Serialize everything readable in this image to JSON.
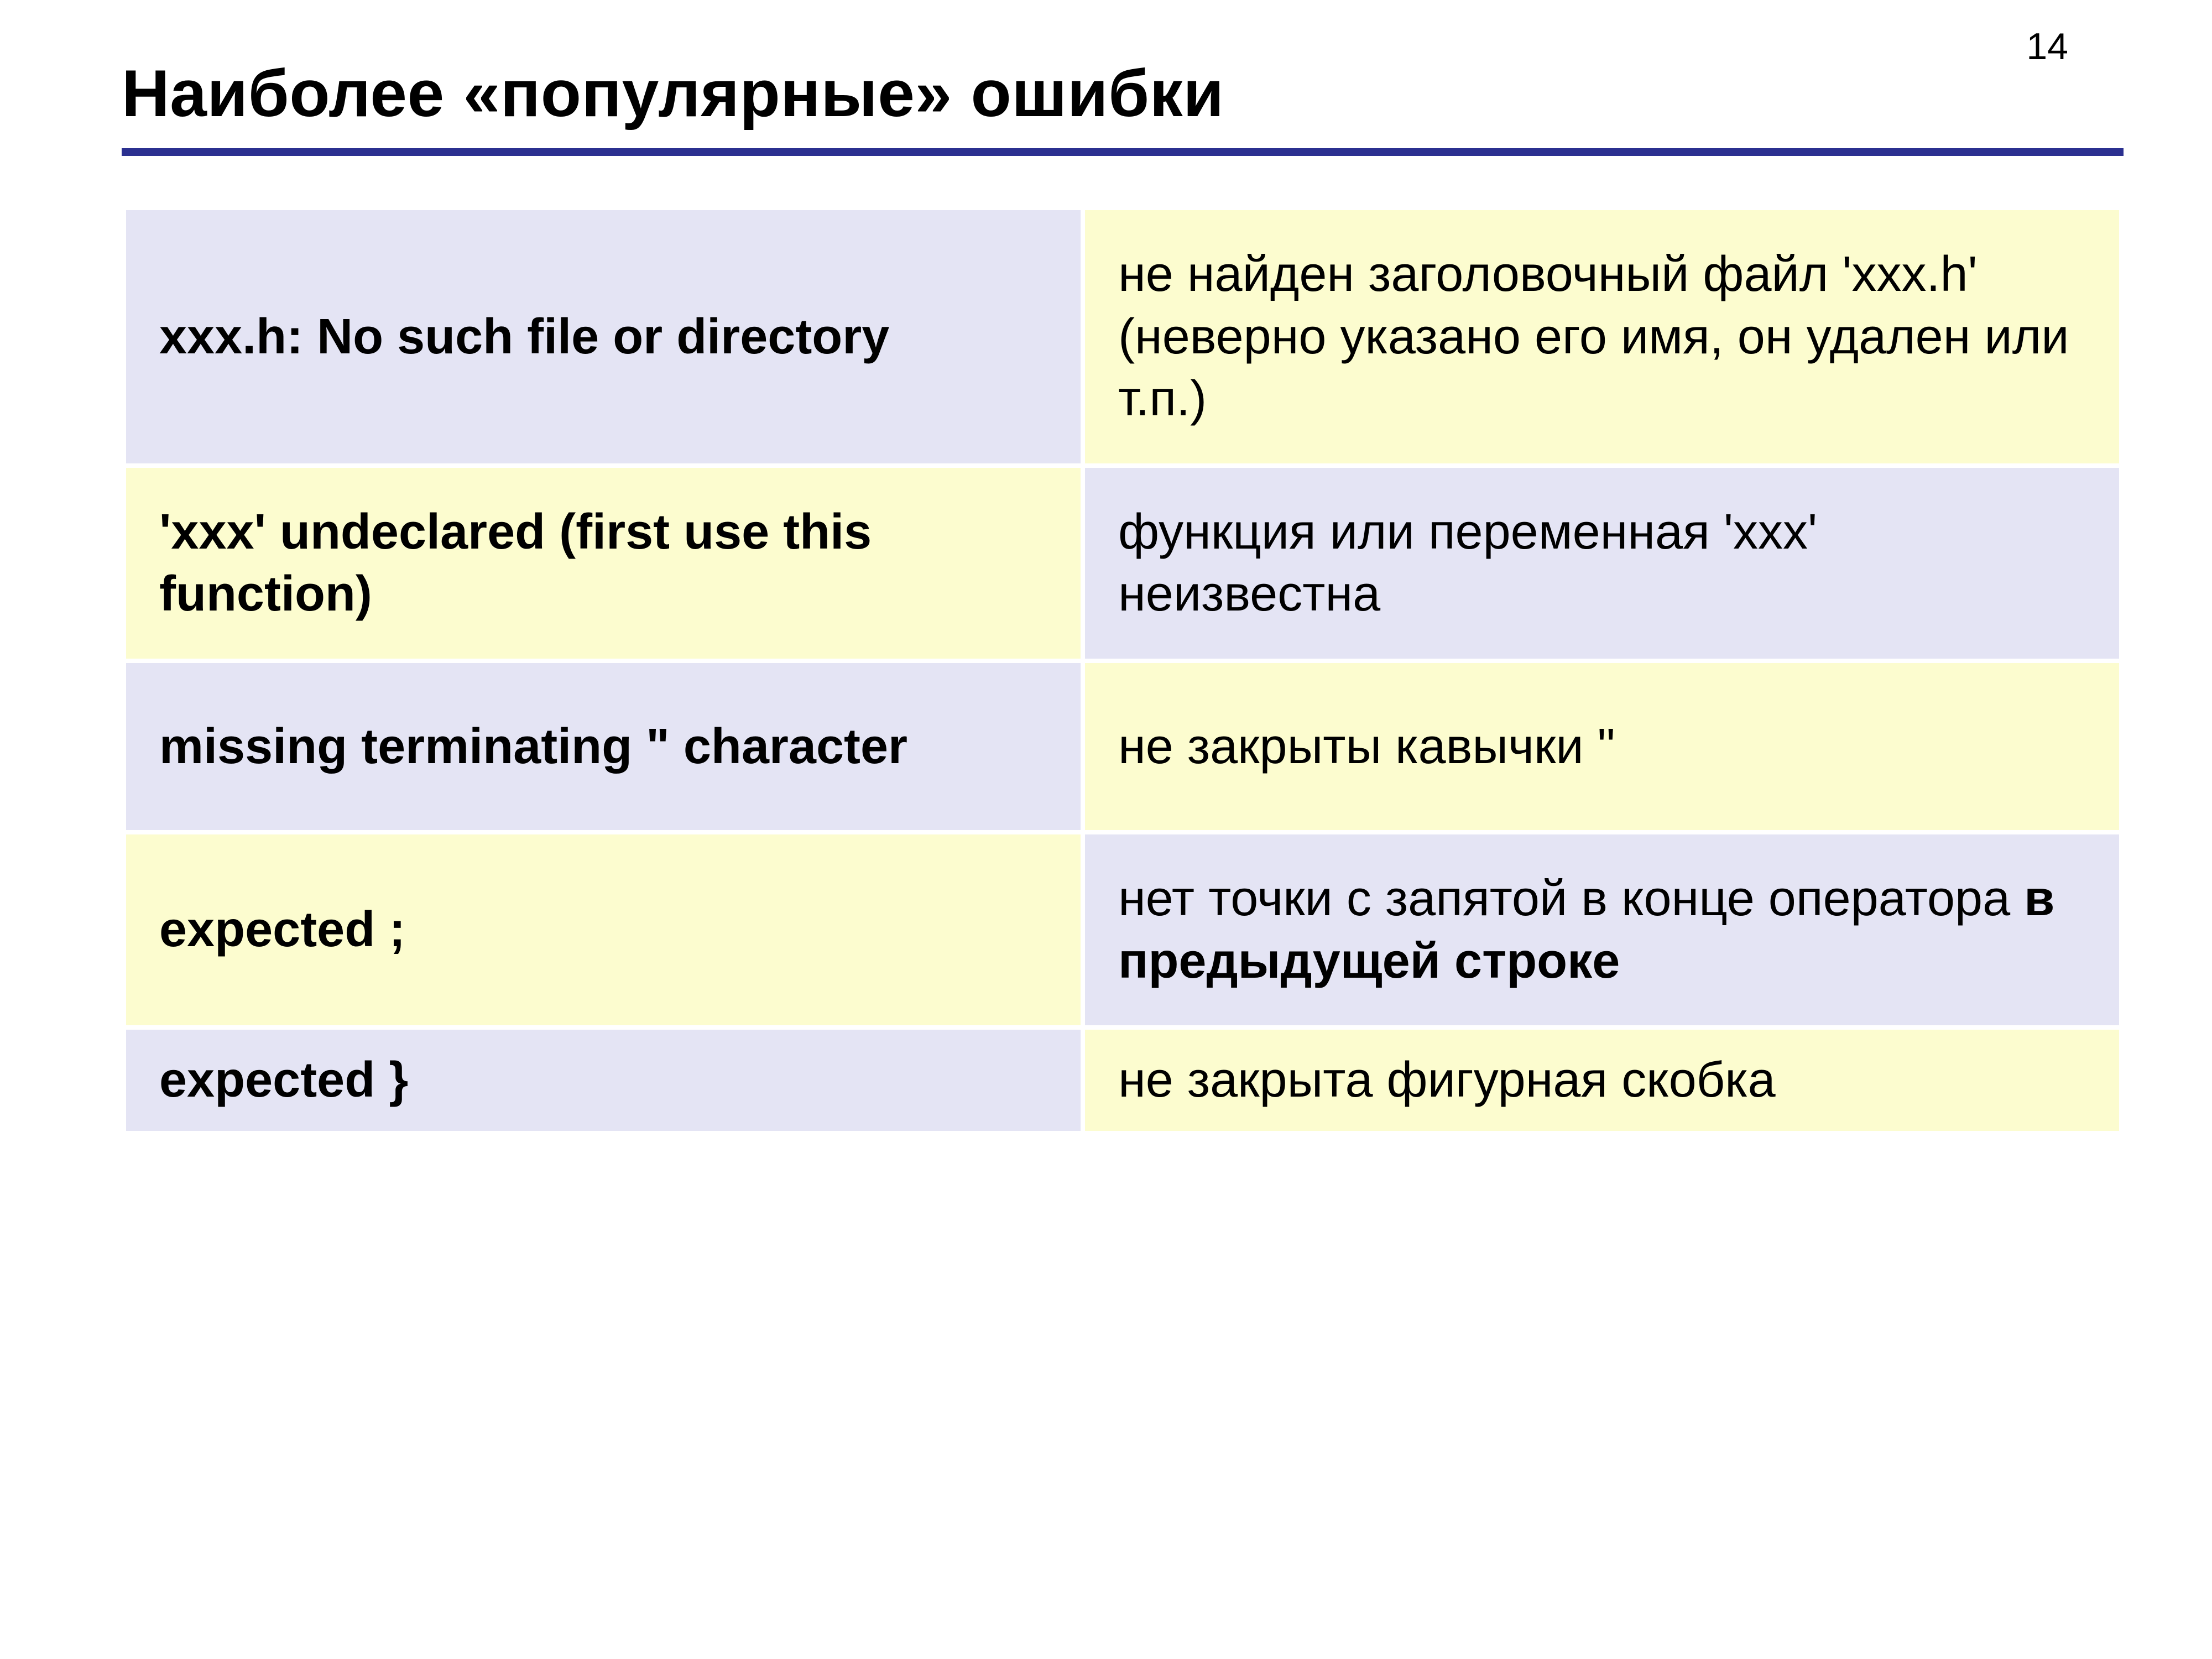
{
  "page_number": "14",
  "title": "Наиболее «популярные» ошибки",
  "rows": [
    {
      "error": "xxx.h: No such file or directory",
      "desc": "не найден заголовочный файл 'xxx.h' (неверно указано его имя, он удален или т.п.)"
    },
    {
      "error": "'xxx' undeclared (first use this function)",
      "desc": "функция или переменная 'xxx' неизвестна"
    },
    {
      "error": "missing terminating \" character",
      "desc": "не закрыты кавычки \""
    },
    {
      "error": "expected  ;",
      "desc_pre": "нет точки с запятой в конце оператора ",
      "desc_bold": "в предыдущей строке"
    },
    {
      "error": "expected  }",
      "desc": "не закрыта фигурная скобка"
    }
  ]
}
